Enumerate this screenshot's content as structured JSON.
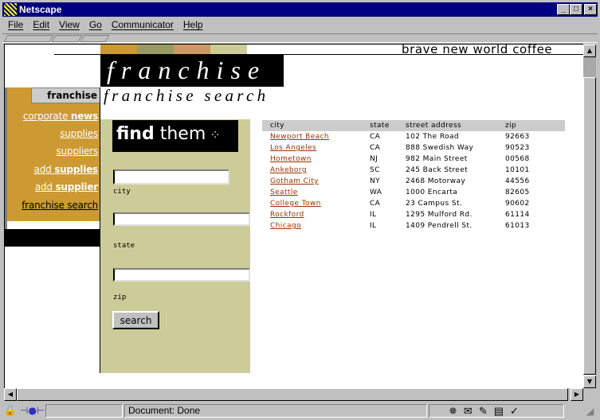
{
  "window": {
    "title": "Netscape",
    "minimize": "_",
    "maximize": "□",
    "close": "×"
  },
  "menu": [
    "File",
    "Edit",
    "View",
    "Go",
    "Communicator",
    "Help"
  ],
  "header": {
    "tagline": "brave new world coffee",
    "banner": "franchise",
    "subtitle": "franchise search"
  },
  "colors": {
    "orange": "#cc9933",
    "olive": "#999966",
    "tan": "#cc9966",
    "beige": "#cccc99",
    "link": "#993300"
  },
  "sidebar": {
    "tab": "franchise",
    "links": [
      {
        "pre": "corporate ",
        "bold": "news"
      },
      {
        "pre": "supplies",
        "bold": ""
      },
      {
        "pre": "suppliers",
        "bold": ""
      },
      {
        "pre": "add ",
        "bold": "supplies"
      },
      {
        "pre": "add ",
        "bold": "supplier"
      },
      {
        "pre": "franchise search",
        "bold": ""
      }
    ]
  },
  "form": {
    "heading_bold": "find",
    "heading_light": "them",
    "city_label": "city",
    "state_label": "state",
    "zip_label": "zip",
    "city_value": "",
    "state_value": "",
    "zip_value": "",
    "search_button": "search"
  },
  "results": {
    "columns": [
      "city",
      "state",
      "street address",
      "zip"
    ],
    "rows": [
      [
        "Newport Beach",
        "CA",
        "102 The Road",
        "92663"
      ],
      [
        "Los Angeles",
        "CA",
        "888 Swedish Way",
        "90523"
      ],
      [
        "Hometown",
        "NJ",
        "982 Main Street",
        "00568"
      ],
      [
        "Ankeborg",
        "SC",
        "245 Back Street",
        "10101"
      ],
      [
        "Gotham City",
        "NY",
        "2468 Motorway",
        "44556"
      ],
      [
        "Seattle",
        "WA",
        "1000 Encarta",
        "82605"
      ],
      [
        "College Town",
        "CA",
        "23 Campus St.",
        "90602"
      ],
      [
        "Rockford",
        "IL",
        "1295 Mulford Rd.",
        "61114"
      ],
      [
        "Chicago",
        "IL",
        "1409 Pendrell St.",
        "61013"
      ]
    ]
  },
  "statusbar": {
    "text": "Document: Done"
  }
}
